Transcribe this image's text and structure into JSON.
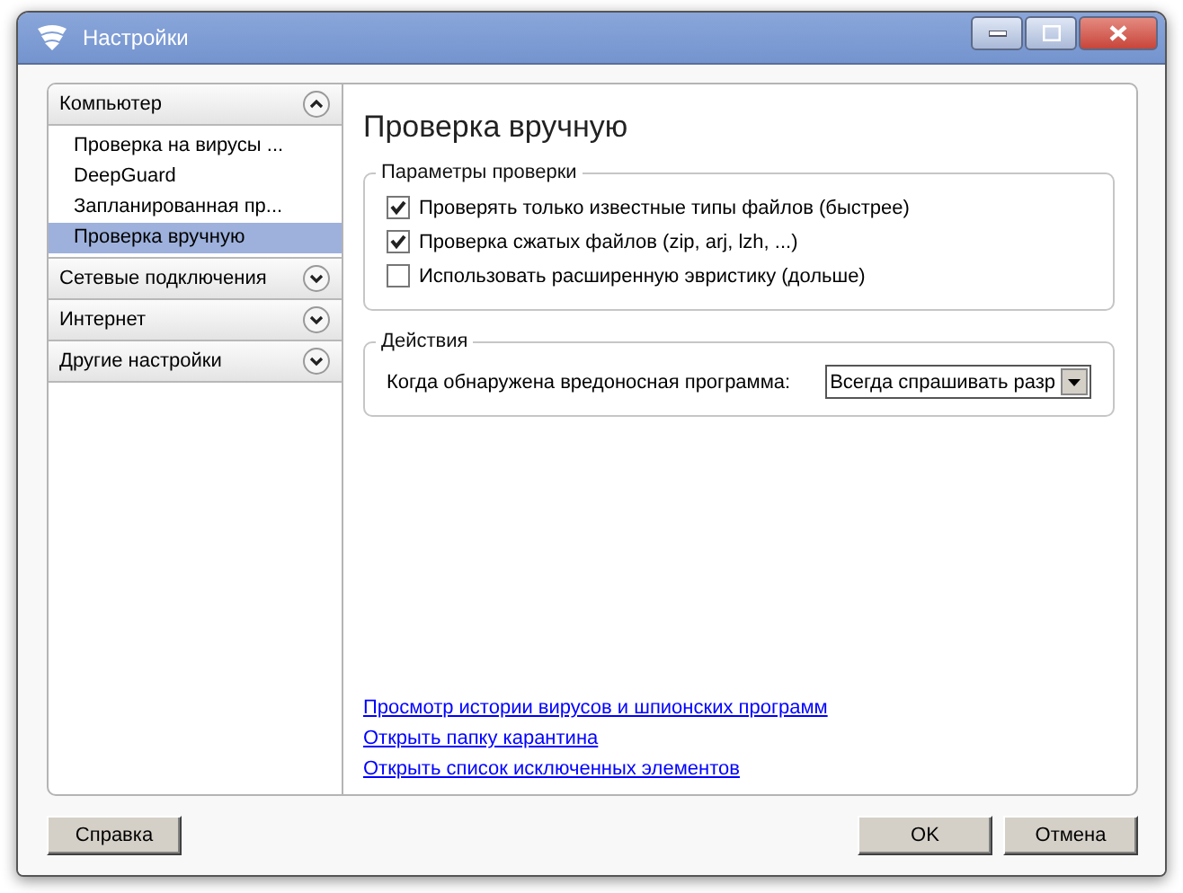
{
  "window": {
    "title": "Настройки"
  },
  "sidebar": {
    "sections": [
      {
        "label": "Компьютер",
        "expanded": true,
        "items": [
          {
            "label": "Проверка на вирусы ...",
            "selected": false
          },
          {
            "label": "DeepGuard",
            "selected": false
          },
          {
            "label": "Запланированная пр...",
            "selected": false
          },
          {
            "label": "Проверка вручную",
            "selected": true
          }
        ]
      },
      {
        "label": "Сетевые подключения",
        "expanded": false
      },
      {
        "label": "Интернет",
        "expanded": false
      },
      {
        "label": "Другие настройки",
        "expanded": false
      }
    ]
  },
  "page": {
    "title": "Проверка вручную",
    "scan_options": {
      "title": "Параметры проверки",
      "options": [
        {
          "label": "Проверять только известные типы файлов (быстрее)",
          "checked": true
        },
        {
          "label": "Проверка сжатых файлов (zip, arj, lzh, ...)",
          "checked": true
        },
        {
          "label": "Использовать расширенную эвристику (дольше)",
          "checked": false
        }
      ]
    },
    "actions": {
      "title": "Действия",
      "label": "Когда обнаружена вредоносная программа:",
      "value": "Всегда спрашивать разр"
    },
    "links": [
      "Просмотр истории вирусов и шпионских программ",
      "Открыть папку карантина",
      "Открыть список исключенных элементов"
    ]
  },
  "buttons": {
    "help": "Справка",
    "ok": "OK",
    "cancel": "Отмена"
  }
}
